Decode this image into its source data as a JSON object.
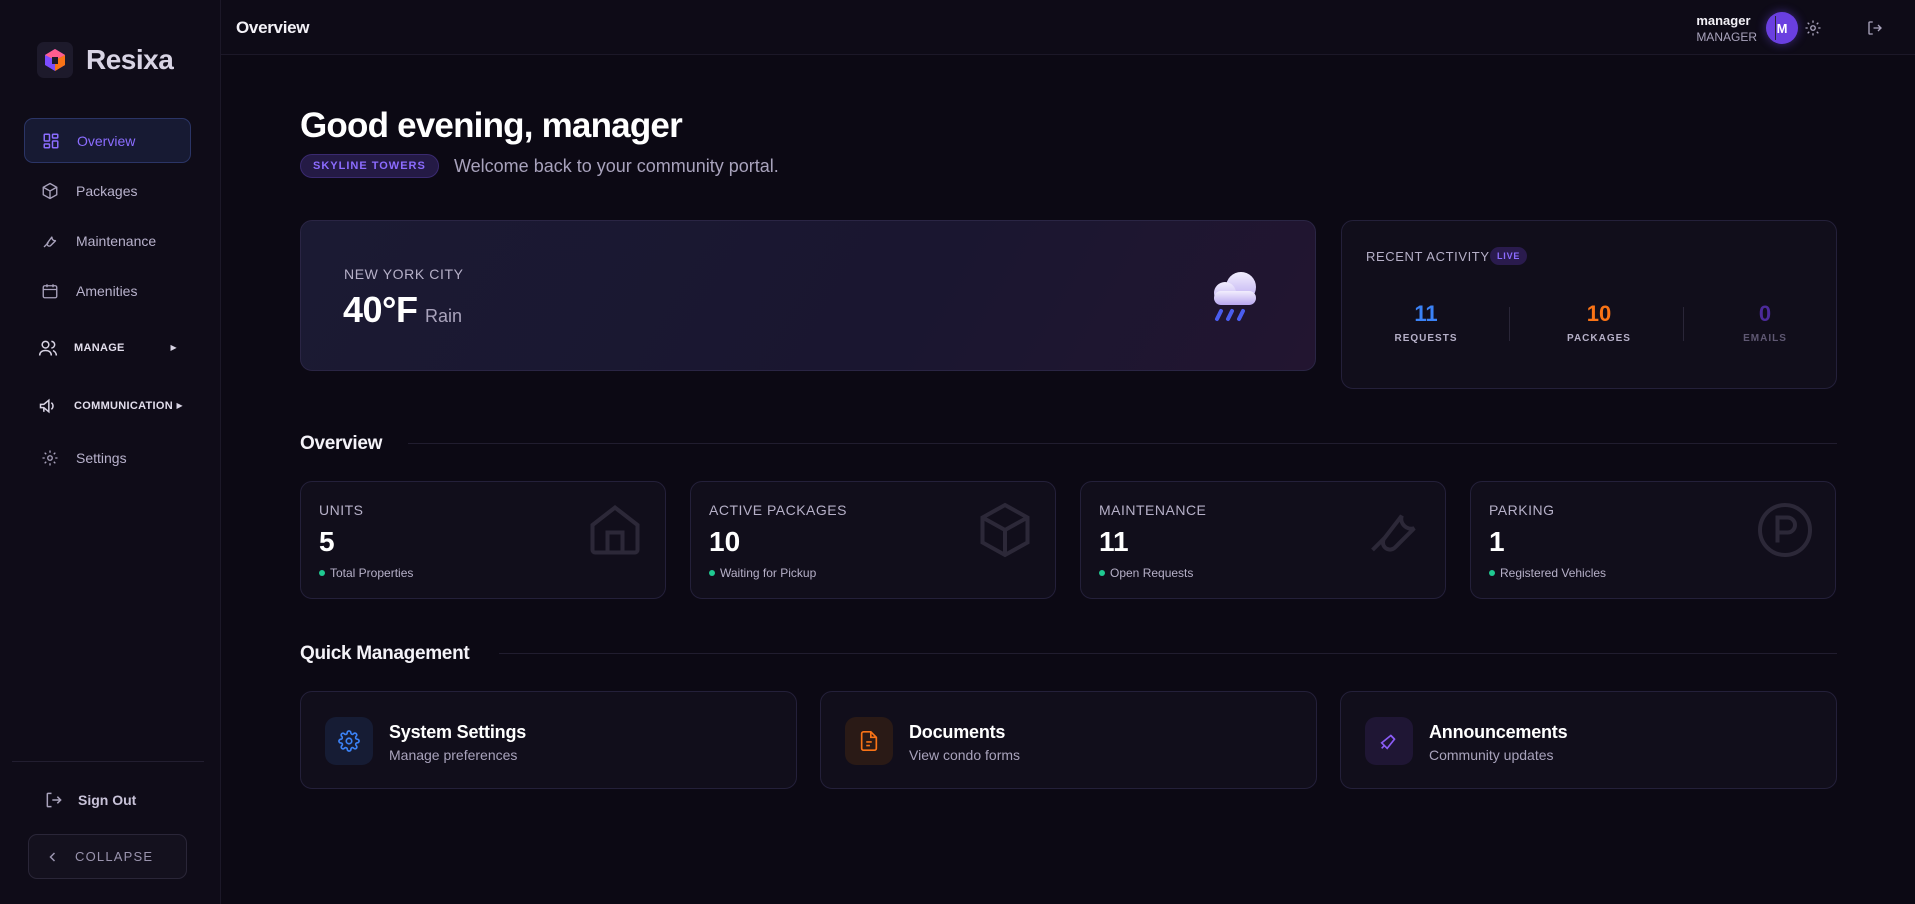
{
  "brand": {
    "name": "Resixa"
  },
  "sidebar": {
    "items": [
      {
        "label": "Overview",
        "icon": "grid-icon"
      },
      {
        "label": "Packages",
        "icon": "package-icon"
      },
      {
        "label": "Maintenance",
        "icon": "wrench-icon"
      },
      {
        "label": "Amenities",
        "icon": "calendar-icon"
      },
      {
        "label": "MANAGE",
        "icon": "users-icon"
      },
      {
        "label": "COMMUNICATION",
        "icon": "megaphone-icon"
      },
      {
        "label": "Settings",
        "icon": "gear-icon"
      }
    ],
    "sign_out": "Sign Out",
    "collapse": "COLLAPSE"
  },
  "header": {
    "title": "Overview",
    "user_name": "manager",
    "user_role": "MANAGER",
    "avatar_initial": "M"
  },
  "greeting": {
    "title": "Good evening, manager",
    "building": "SKYLINE TOWERS",
    "welcome": "Welcome back to your community portal."
  },
  "weather": {
    "city": "NEW YORK CITY",
    "temp": "40°F",
    "condition": "Rain",
    "icon": "rain-cloud-icon"
  },
  "activity": {
    "title": "RECENT ACTIVITY",
    "badge": "LIVE",
    "stats": [
      {
        "value": "11",
        "label": "REQUESTS",
        "color": "#3b82f6"
      },
      {
        "value": "10",
        "label": "PACKAGES",
        "color": "#f97316"
      },
      {
        "value": "0",
        "label": "EMAILS",
        "color": "#4c2a9a"
      }
    ]
  },
  "overview": {
    "title": "Overview",
    "cards": [
      {
        "label": "UNITS",
        "value": "5",
        "sub": "Total Properties",
        "icon": "home-icon"
      },
      {
        "label": "ACTIVE PACKAGES",
        "value": "10",
        "sub": "Waiting for Pickup",
        "icon": "box-icon"
      },
      {
        "label": "MAINTENANCE",
        "value": "11",
        "sub": "Open Requests",
        "icon": "wrench-icon"
      },
      {
        "label": "PARKING",
        "value": "1",
        "sub": "Registered Vehicles",
        "icon": "parking-icon"
      }
    ]
  },
  "quick": {
    "title": "Quick Management",
    "cards": [
      {
        "title": "System Settings",
        "sub": "Manage preferences",
        "icon": "gear-icon",
        "color": "#3b82f6"
      },
      {
        "title": "Documents",
        "sub": "View condo forms",
        "icon": "document-icon",
        "color": "#f97316"
      },
      {
        "title": "Announcements",
        "sub": "Community updates",
        "icon": "megaphone-icon",
        "color": "#8b5cf6"
      }
    ]
  }
}
